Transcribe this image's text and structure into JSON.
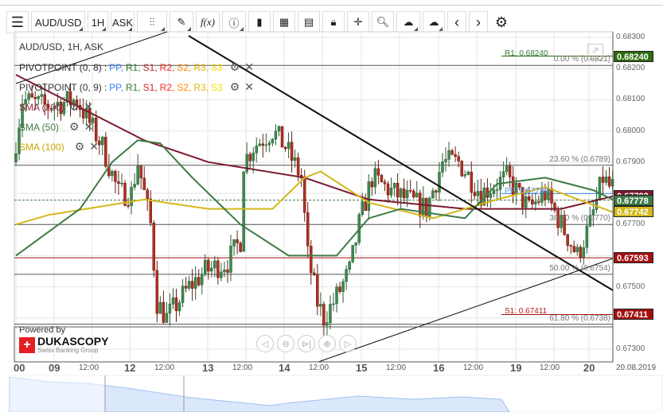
{
  "toolbar": {
    "symbol": "AUD/USD",
    "timeframe": "1H",
    "side": "ASK",
    "icons": [
      "menu-icon",
      "candles-icon",
      "pencil-icon",
      "function-icon",
      "info-icon",
      "bar-chart-icon",
      "calendar-icon",
      "report-icon",
      "lock-icon",
      "crosshair-icon",
      "zoom-icon",
      "upload-icon",
      "download-icon",
      "prev-icon",
      "next-icon",
      "gear-icon"
    ],
    "fx": "f(x)"
  },
  "chart": {
    "title": "AUD/USD, 1H, ASK",
    "pivot1": {
      "label": "PIVOTPOINT (0, 8)",
      "items": [
        "PP",
        "R1",
        "S1",
        "R2",
        "S2",
        "R3",
        "S3"
      ]
    },
    "pivot2": {
      "label": "PIVOTPOINT (0, 9)",
      "items": [
        "PP",
        "R1",
        "S1",
        "R2",
        "S2",
        "R3",
        "S3"
      ]
    },
    "sma200": "SMA (200)",
    "sma50": "SMA (50)",
    "sma100": "SMA (100)",
    "r1_label": "R1: 0.68240",
    "s1_label": "S1: 0.67411",
    "pp_label": "PP: 0.67799",
    "fib": [
      "0.00 % (0.6821)",
      "23.60 % (0.6789)",
      "38.20 % (0.6770)",
      "50.00 % (0.6754)",
      "61.80 % (0.6738)"
    ],
    "badges": [
      {
        "text": "0.68240",
        "color": "#2e6b10",
        "price": 0.6824
      },
      {
        "text": "0.67792",
        "color": "#7b1a2e",
        "price": 0.67792
      },
      {
        "text": "0.67778",
        "color": "#3e7a46",
        "price": 0.67778
      },
      {
        "text": "0.67742",
        "color": "#d4b81a",
        "price": 0.67742
      },
      {
        "text": "0.67593",
        "color": "#a30f0f",
        "price": 0.67593
      },
      {
        "text": "0.67411",
        "color": "#a30f0f",
        "price": 0.67411
      }
    ],
    "y_ticks": [
      "0.68300",
      "0.68200",
      "0.68100",
      "0.68000",
      "0.67900",
      "0.67700",
      "0.67500",
      "0.67300"
    ],
    "x_days": [
      "00",
      "09",
      "12",
      "13",
      "14",
      "15",
      "16",
      "19",
      "20"
    ],
    "x_noon": "12:00",
    "x_date": "20.08.2019",
    "powered": "Powered by",
    "brand": "DUKASCOPY",
    "brand_sub": "Swiss Banking Group",
    "price_anchors": [
      [
        0,
        0.679
      ],
      [
        3,
        0.681
      ],
      [
        10,
        0.6808
      ],
      [
        20,
        0.681
      ],
      [
        28,
        0.6795
      ],
      [
        33,
        0.678
      ],
      [
        37,
        0.678
      ],
      [
        39,
        0.679
      ],
      [
        43,
        0.677
      ],
      [
        45,
        0.6745
      ],
      [
        48,
        0.674
      ],
      [
        55,
        0.675
      ],
      [
        60,
        0.6755
      ],
      [
        67,
        0.6758
      ],
      [
        71,
        0.6765
      ],
      [
        72,
        0.679
      ],
      [
        75,
        0.6795
      ],
      [
        81,
        0.68
      ],
      [
        85,
        0.6795
      ],
      [
        90,
        0.6785
      ],
      [
        92,
        0.676
      ],
      [
        95,
        0.6745
      ],
      [
        97,
        0.674
      ],
      [
        100,
        0.6745
      ],
      [
        105,
        0.6755
      ],
      [
        108,
        0.677
      ],
      [
        112,
        0.6785
      ],
      [
        119,
        0.678
      ],
      [
        129,
        0.6775
      ],
      [
        134,
        0.679
      ],
      [
        139,
        0.679
      ],
      [
        146,
        0.678
      ],
      [
        154,
        0.6785
      ],
      [
        161,
        0.6775
      ],
      [
        166,
        0.678
      ],
      [
        171,
        0.677
      ],
      [
        176,
        0.676
      ],
      [
        180,
        0.677
      ],
      [
        184,
        0.6785
      ],
      [
        186,
        0.6782
      ]
    ],
    "sma200_pts": [
      [
        0,
        0.6818
      ],
      [
        40,
        0.6797
      ],
      [
        60,
        0.679
      ],
      [
        90,
        0.6785
      ],
      [
        110,
        0.6778
      ],
      [
        140,
        0.6775
      ],
      [
        170,
        0.6775
      ],
      [
        186,
        0.6779
      ]
    ],
    "sma50_pts": [
      [
        0,
        0.676
      ],
      [
        20,
        0.6775
      ],
      [
        30,
        0.679
      ],
      [
        38,
        0.6797
      ],
      [
        45,
        0.6796
      ],
      [
        55,
        0.6785
      ],
      [
        70,
        0.677
      ],
      [
        85,
        0.676
      ],
      [
        100,
        0.676
      ],
      [
        110,
        0.6772
      ],
      [
        120,
        0.6775
      ],
      [
        140,
        0.6772
      ],
      [
        150,
        0.6783
      ],
      [
        165,
        0.6785
      ],
      [
        180,
        0.6781
      ],
      [
        186,
        0.6778
      ]
    ],
    "sma100_pts": [
      [
        0,
        0.677
      ],
      [
        10,
        0.6773
      ],
      [
        40,
        0.6778
      ],
      [
        60,
        0.6775
      ],
      [
        80,
        0.6775
      ],
      [
        90,
        0.6785
      ],
      [
        95,
        0.6787
      ],
      [
        110,
        0.6777
      ],
      [
        130,
        0.6772
      ],
      [
        150,
        0.6778
      ],
      [
        165,
        0.6782
      ],
      [
        178,
        0.6777
      ],
      [
        186,
        0.6774
      ]
    ]
  },
  "colors": {
    "pp": "#3b82f6",
    "r1": "#2e7d32",
    "s1": "#c62828",
    "r2": "#ff2a2a",
    "s2": "#ff8c00",
    "r3": "#e6b800",
    "s3": "#f5e000",
    "up": "#3c8a4e",
    "down": "#b03020"
  }
}
